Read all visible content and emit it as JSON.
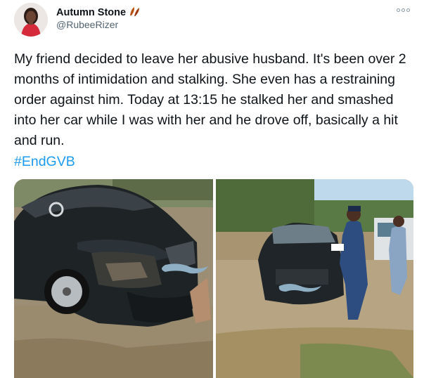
{
  "author": {
    "display_name": "Autumn Stone",
    "handle": "@RubeeRizer",
    "name_emoji": "leaf-emoji"
  },
  "tweet": {
    "text": "My friend decided to leave her abusive husband. It's been over 2 months of intimidation and stalking. She even has a restraining order against him. Today at 13:15 he stalked her and smashed into her car while I was with her and he drove off, basically a hit and run.",
    "hashtag": "#EndGVB"
  },
  "icons": {
    "more": "more-dots-icon",
    "mustache": "mustache-sticker"
  },
  "colors": {
    "text": "#0f1419",
    "secondary": "#536471",
    "link": "#1d9bf0",
    "leaf": "#c0562a"
  }
}
